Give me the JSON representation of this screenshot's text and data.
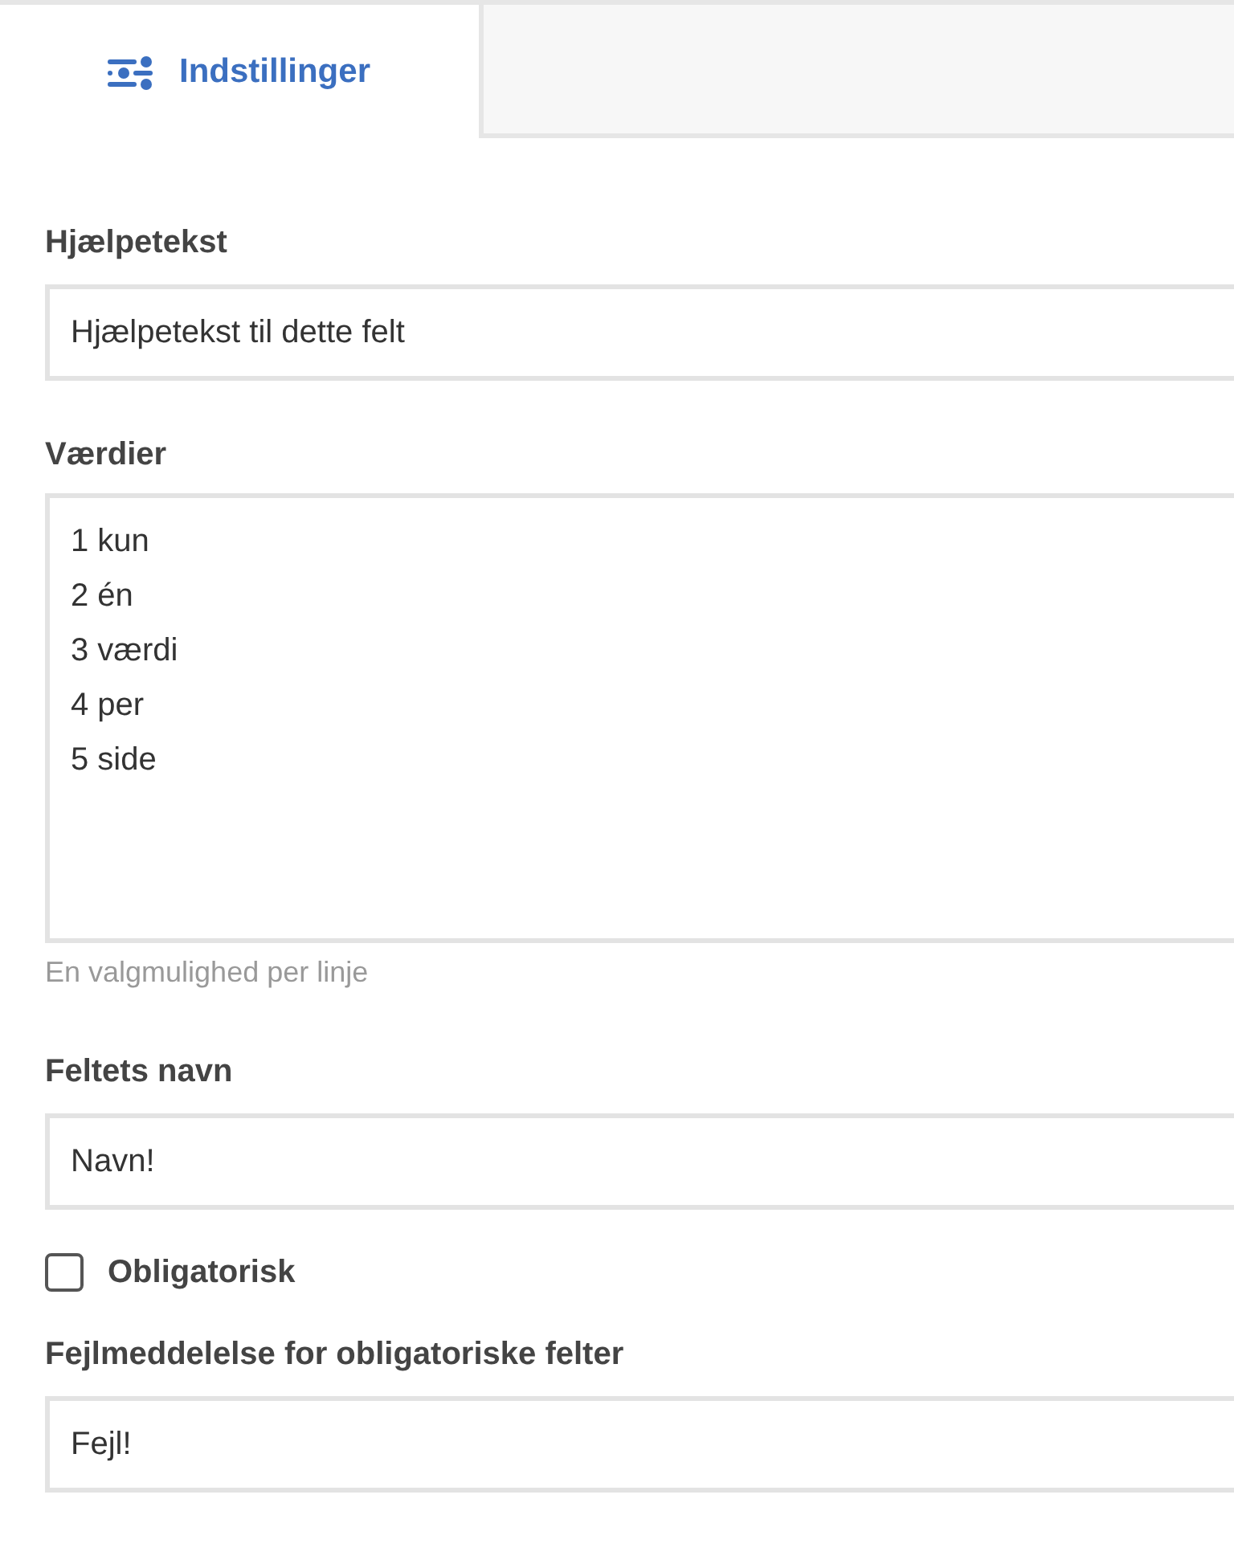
{
  "tabs": [
    {
      "label": "Indstillinger",
      "selected": true
    },
    {
      "selected": false
    }
  ],
  "fields": [
    {
      "kind": "input",
      "label": "Hjælpetekst",
      "value": "Hjælpetekst til dette felt"
    },
    {
      "kind": "textarea",
      "label": "Værdier",
      "value": "1 kun\n2 én\n3 værdi\n4 per\n5 side",
      "hint": "En valgmulighed per linje"
    },
    {
      "kind": "input",
      "label": "Feltets navn",
      "value": "Navn!"
    },
    {
      "kind": "checkbox",
      "label": "Obligatorisk",
      "checked": false
    },
    {
      "kind": "input",
      "label": "Fejlmeddelelse for obligatoriske felter",
      "value": "Fejl!"
    }
  ]
}
